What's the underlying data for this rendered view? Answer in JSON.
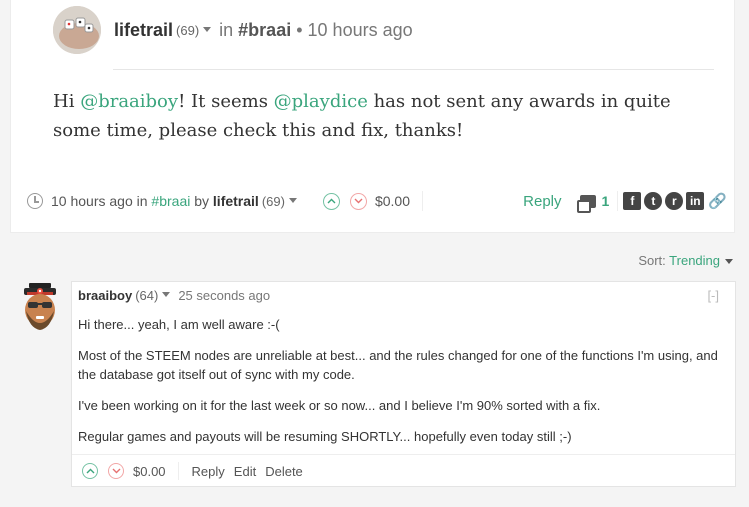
{
  "post": {
    "author": "lifetrail",
    "reputation": "(69)",
    "in_text": "in",
    "category": "#braai",
    "dot": "•",
    "time": "10 hours ago",
    "body": {
      "greeting": "Hi ",
      "mention1": "@braaiboy",
      "part2": "! It seems ",
      "mention2": "@playdice",
      "part3": " has not sent any awards in quite some time, please check this and fix, thanks!"
    },
    "footer": {
      "time": "10 hours ago",
      "in_text": "in",
      "category": "#braai",
      "by_text": "by",
      "author": "lifetrail",
      "reputation": "(69)",
      "payout": "$0.00",
      "reply_label": "Reply",
      "comment_count": "1",
      "share_facebook": "f",
      "share_twitter": "t",
      "share_reddit": "r",
      "share_linkedin": "in"
    }
  },
  "sort": {
    "label": "Sort:",
    "value": "Trending"
  },
  "comment": {
    "author": "braaiboy",
    "reputation": "(64)",
    "time": "25 seconds ago",
    "collapse_label": "[-]",
    "paragraphs": [
      "Hi there... yeah, I am well aware :-(",
      "Most of the STEEM nodes are unreliable at best... and the rules changed for one of the functions I'm using, and the database got itself out of sync with my code.",
      "I've been working on it for the last week or so now... and I believe I'm 90% sorted with a fix.",
      "Regular games and payouts will be resuming SHORTLY... hopefully even today still ;-)"
    ],
    "payout": "$0.00",
    "reply_label": "Reply",
    "edit_label": "Edit",
    "delete_label": "Delete"
  },
  "icons": {
    "upvote": "chevron-up",
    "downvote": "chevron-down",
    "clock": "clock-icon",
    "comments": "comments-icon",
    "link": "link-icon"
  },
  "colors": {
    "accent": "#3aa57d",
    "downvote": "#e67272"
  }
}
